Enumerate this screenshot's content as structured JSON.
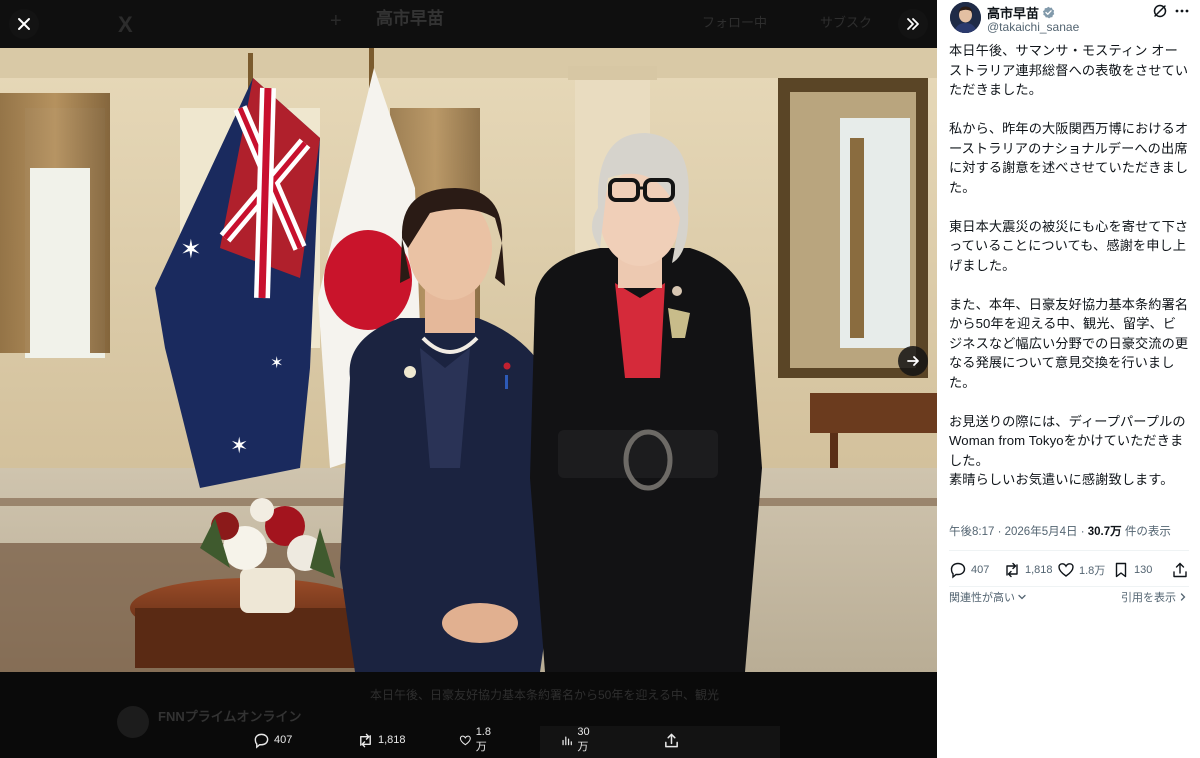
{
  "background": {
    "logo": "X",
    "plus": "+",
    "account_name": "高市早苗",
    "follow_tab": "フォロー中",
    "subscribe_tab": "サブスク",
    "caption": "本日午後、日豪友好協力基本条約署名から50年を迎える中、観光",
    "quoted_account": "FNNプライムオンライン"
  },
  "viewer_actions": {
    "replies": "407",
    "reposts": "1,818",
    "likes": "1.8万",
    "views": "30万"
  },
  "author": {
    "name": "高市早苗",
    "handle": "@takaichi_sanae"
  },
  "post": {
    "paragraphs": [
      "本日午後、サマンサ・モスティン オーストラリア連邦総督への表敬をさせていただきました。",
      "私から、昨年の大阪関西万博におけるオーストラリアのナショナルデーへの出席に対する謝意を述べさせていただきました。",
      "東日本大震災の被災にも心を寄せて下さっていることについても、感謝を申し上げました。",
      "また、本年、日豪友好協力基本条約署名から50年を迎える中、観光、留学、ビジネスなど幅広い分野での日豪交流の更なる発展について意見交換を行いました。",
      "お見送りの際には、ディープパープルのWoman from Tokyoをかけていただきました。",
      "素晴らしいお気遣いに感謝致します。"
    ],
    "time": "午後8:17",
    "date": "2026年5月4日",
    "views_count": "30.7万",
    "views_label": "件の表示",
    "separator": " · "
  },
  "panel_actions": {
    "replies": "407",
    "reposts": "1,818",
    "likes": "1.8万",
    "bookmarks": "130"
  },
  "replies_bar": {
    "sort_label": "関連性が高い",
    "quotes_label": "引用を表示"
  },
  "colors": {
    "accent_blue": "#1d9bf0",
    "muted_text": "#536471"
  }
}
